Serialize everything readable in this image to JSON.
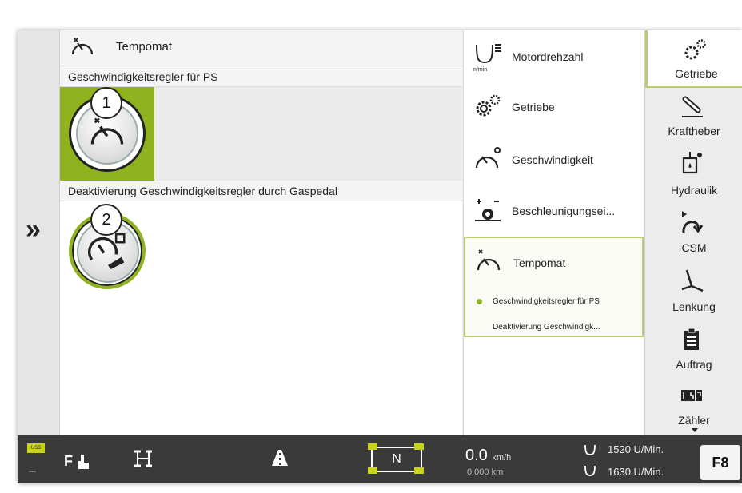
{
  "main": {
    "header_title": "Tempomat",
    "section1_title": "Geschwindigkeitsregler für PS",
    "section2_title": "Deaktivierung Geschwindigkeitsregler durch Gaspedal",
    "callout1": "1",
    "callout2": "2"
  },
  "submenu": {
    "items": [
      {
        "label": "Motordrehzahl",
        "icon": "engine-speed-icon",
        "icon_caption": "n/min"
      },
      {
        "label": "Getriebe",
        "icon": "gears-icon"
      },
      {
        "label": "Geschwindigkeit",
        "icon": "speedometer-icon"
      },
      {
        "label": "Beschleunigungsei...",
        "icon": "acceleration-icon"
      }
    ],
    "active": {
      "label": "Tempomat",
      "subitems": [
        "Geschwindigkeitsregler für PS",
        "Deaktivierung Geschwindigk..."
      ]
    }
  },
  "rightbar": {
    "items": [
      {
        "label": "Getriebe",
        "icon": "gears-icon",
        "active": true
      },
      {
        "label": "Kraftheber",
        "icon": "hitch-icon"
      },
      {
        "label": "Hydraulik",
        "icon": "hydraulics-icon"
      },
      {
        "label": "CSM",
        "icon": "csm-icon"
      },
      {
        "label": "Lenkung",
        "icon": "steering-icon"
      },
      {
        "label": "Auftrag",
        "icon": "clipboard-icon"
      },
      {
        "label": "Zähler",
        "icon": "counter-icon"
      }
    ]
  },
  "bottombar": {
    "speed_value": "0.0",
    "speed_unit": "km/h",
    "distance": "0.000 km",
    "rpm1": "1520 U/Min.",
    "rpm2": "1630 U/Min.",
    "gear": "N",
    "function_key": "F8",
    "usb_label": "USB",
    "dashes": "---"
  },
  "colors": {
    "accent_green": "#8fb21f",
    "active_border": "#b8cc74",
    "bottombar_bg": "#3a3a3a"
  }
}
